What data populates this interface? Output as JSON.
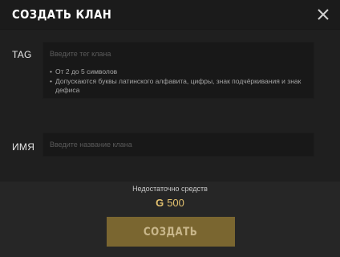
{
  "dialog": {
    "title": "Создать клан",
    "close_icon": "close-icon"
  },
  "tag_field": {
    "label": "TAG",
    "placeholder": "Введите тег клана",
    "value": "",
    "hints": [
      "От 2 до 5 символов",
      "Допускаются буквы латинского алфавита, цифры, знак подчёркивания и знак дефиса"
    ]
  },
  "name_field": {
    "label": "Имя",
    "placeholder": "Введите название клана",
    "value": ""
  },
  "footer": {
    "insufficient_funds": "Недостаточно средств",
    "currency_icon": "gold-currency-icon",
    "currency_symbol": "G",
    "price": "500",
    "create_button_label": "Создать"
  },
  "colors": {
    "background": "#1f1f1f",
    "input_background": "#181818",
    "accent_gold": "#e3c16f",
    "button_disabled": "#7a6630"
  }
}
